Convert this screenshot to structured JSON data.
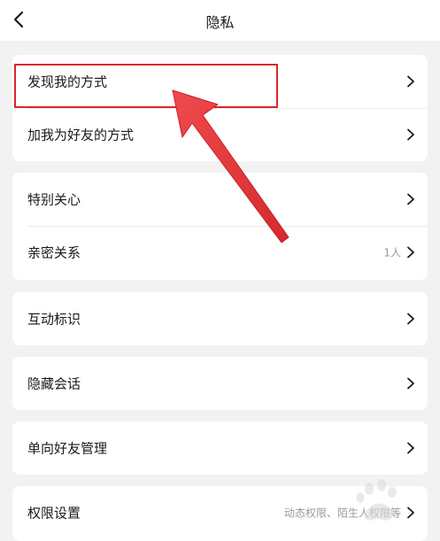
{
  "header": {
    "title": "隐私",
    "back_icon": "chevron-left-icon"
  },
  "groups": [
    {
      "items": [
        {
          "label": "发现我的方式"
        },
        {
          "label": "加我为好友的方式"
        }
      ]
    },
    {
      "items": [
        {
          "label": "特别关心"
        },
        {
          "label": "亲密关系",
          "value": "1人"
        }
      ]
    },
    {
      "items": [
        {
          "label": "互动标识"
        }
      ]
    },
    {
      "items": [
        {
          "label": "隐藏会话"
        }
      ]
    },
    {
      "items": [
        {
          "label": "单向好友管理"
        }
      ]
    },
    {
      "items": [
        {
          "label": "权限设置",
          "value": "动态权限、陌生人权限等"
        }
      ]
    }
  ],
  "annotation": {
    "highlight_color": "#d9272c",
    "arrow_color": "#e8383b"
  },
  "colors": {
    "background": "#f2f2f2",
    "card": "#ffffff",
    "text": "#1a1a1a",
    "secondary_text": "#9a9a9a"
  }
}
